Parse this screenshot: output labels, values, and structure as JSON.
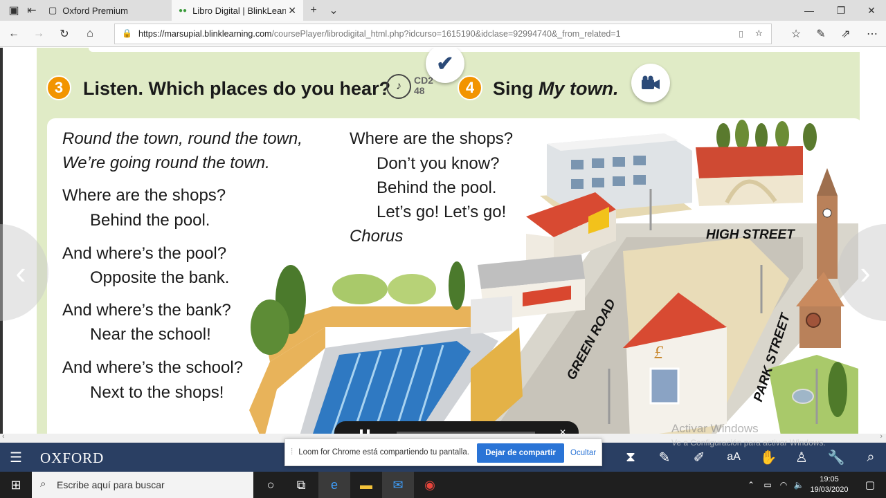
{
  "browser": {
    "tabs": [
      {
        "label": "Oxford Premium"
      },
      {
        "label": "Libro Digital | BlinkLearn"
      }
    ],
    "url": {
      "host": "https://marsupial.blinklearning.com",
      "path": "/coursePlayer/librodigital_html.php?idcurso=1615190&idclase=92994740&_from_related=1"
    }
  },
  "exercise3": {
    "number": "3",
    "title": "Listen. Which places do you hear?",
    "cd": "CD2",
    "track": "48"
  },
  "exercise4": {
    "number": "4",
    "title_prefix": "Sing ",
    "title_song": "My town."
  },
  "song": {
    "col1": [
      {
        "text": "Round the town, round the town,",
        "italic": true,
        "indent": false
      },
      {
        "text": "We’re going round the town.",
        "italic": true,
        "indent": false
      },
      {
        "text": "Where are the shops?",
        "italic": false,
        "indent": false
      },
      {
        "text": "Behind the pool.",
        "italic": false,
        "indent": true
      },
      {
        "text": "And where’s the pool?",
        "italic": false,
        "indent": false
      },
      {
        "text": "Opposite the bank.",
        "italic": false,
        "indent": true
      },
      {
        "text": "And where’s the bank?",
        "italic": false,
        "indent": false
      },
      {
        "text": "Near the school!",
        "italic": false,
        "indent": true
      },
      {
        "text": "And where’s the school?",
        "italic": false,
        "indent": false
      },
      {
        "text": "Next to the shops!",
        "italic": false,
        "indent": true
      }
    ],
    "col2": [
      {
        "text": "Where are the shops?",
        "italic": false,
        "indent": false
      },
      {
        "text": "Don’t you know?",
        "italic": false,
        "indent": true
      },
      {
        "text": "Behind the pool.",
        "italic": false,
        "indent": true
      },
      {
        "text": "Let’s go! Let’s go!",
        "italic": false,
        "indent": true
      },
      {
        "text": "Chorus",
        "italic": true,
        "indent": false
      }
    ]
  },
  "map": {
    "high_street": "HIGH STREET",
    "green_road": "GREEN ROAD",
    "park_street": "PARK STREET",
    "bank_sign": "£"
  },
  "bottombar": {
    "brand": "OXFORD",
    "text_tool": "aA"
  },
  "loom": {
    "message": "Loom for Chrome está compartiendo tu pantalla.",
    "stop": "Dejar de compartir",
    "hide": "Ocultar"
  },
  "watermark": {
    "line1": "Activar Windows",
    "line2": "Ve a Configuración para activar Windows."
  },
  "taskbar": {
    "search_placeholder": "Escribe aquí para buscar",
    "time": "19:05",
    "date": "19/03/2020"
  },
  "colors": {
    "page_bg": "#e0ebc6",
    "number_badge": "#f29400",
    "bottombar": "#2a3f63",
    "loom_button": "#2a74d6"
  }
}
